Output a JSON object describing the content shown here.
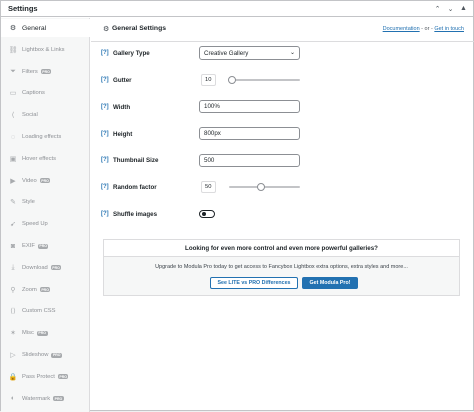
{
  "panel": {
    "title": "Settings"
  },
  "sidebar": {
    "items": [
      {
        "label": "General",
        "icon": "gear-icon",
        "glyph": "⚙",
        "pro": false,
        "active": true
      },
      {
        "label": "Lightbox & Links",
        "icon": "link-icon",
        "glyph": "⛓",
        "pro": false
      },
      {
        "label": "Filters",
        "icon": "filter-icon",
        "glyph": "⏷",
        "pro": true
      },
      {
        "label": "Captions",
        "icon": "caption-icon",
        "glyph": "▭",
        "pro": false
      },
      {
        "label": "Social",
        "icon": "share-icon",
        "glyph": "⟨",
        "pro": false
      },
      {
        "label": "Loading effects",
        "icon": "loading-icon",
        "glyph": "◌",
        "pro": false
      },
      {
        "label": "Hover effects",
        "icon": "hover-icon",
        "glyph": "▣",
        "pro": false
      },
      {
        "label": "Video",
        "icon": "video-icon",
        "glyph": "▶",
        "pro": true
      },
      {
        "label": "Style",
        "icon": "brush-icon",
        "glyph": "✎",
        "pro": false
      },
      {
        "label": "Speed Up",
        "icon": "rocket-icon",
        "glyph": "➹",
        "pro": false
      },
      {
        "label": "EXIF",
        "icon": "camera-icon",
        "glyph": "◙",
        "pro": true
      },
      {
        "label": "Download",
        "icon": "download-icon",
        "glyph": "⤓",
        "pro": true
      },
      {
        "label": "Zoom",
        "icon": "zoom-icon",
        "glyph": "⚲",
        "pro": true
      },
      {
        "label": "Custom CSS",
        "icon": "code-icon",
        "glyph": "⟨⟩",
        "pro": false
      },
      {
        "label": "Misc",
        "icon": "misc-icon",
        "glyph": "✶",
        "pro": true
      },
      {
        "label": "Slideshow",
        "icon": "slideshow-icon",
        "glyph": "▷",
        "pro": true
      },
      {
        "label": "Pass Protect",
        "icon": "lock-icon",
        "glyph": "🔒",
        "pro": true
      },
      {
        "label": "Watermark",
        "icon": "watermark-icon",
        "glyph": "◐",
        "pro": true
      }
    ],
    "pro_label": "PRO"
  },
  "main": {
    "title": "General Settings",
    "doc_link": "Documentation",
    "or_text": "- or -",
    "help_link": "Get in touch"
  },
  "fields": {
    "help_mark": "[?]",
    "gallery_type": {
      "label": "Gallery Type",
      "value": "Creative Gallery"
    },
    "gutter": {
      "label": "Gutter",
      "value": "10"
    },
    "width": {
      "label": "Width",
      "value": "100%"
    },
    "height": {
      "label": "Height",
      "value": "800px"
    },
    "thumbnail_size": {
      "label": "Thumbnail Size",
      "value": "500"
    },
    "random_factor": {
      "label": "Random factor",
      "value": "50"
    },
    "shuffle_images": {
      "label": "Shuffle images",
      "enabled": false
    }
  },
  "promo": {
    "title": "Looking for even more control and even more powerful galleries?",
    "text": "Upgrade to Modula Pro today to get access to Fancybox Lightbox extra options, extra styles and more...",
    "compare_button": "See LITE vs PRO Differences",
    "pro_button": "Get Modula Pro!"
  },
  "colors": {
    "accent": "#2271b1",
    "text": "#1d2327",
    "muted": "#8c8f94"
  }
}
